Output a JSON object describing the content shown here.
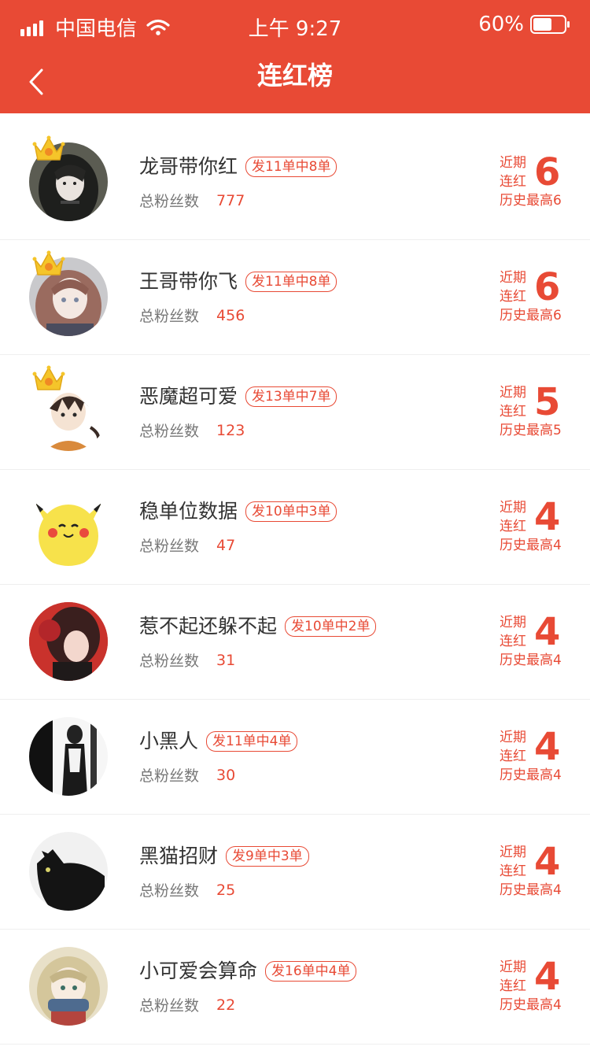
{
  "status_bar": {
    "carrier": "中国电信",
    "time": "上午 9:27",
    "battery": "60%",
    "battery_level": 0.6
  },
  "nav": {
    "title": "连红榜",
    "back_icon": "chevron-left-icon"
  },
  "colors": {
    "accent": "#e84a35",
    "text_primary": "#333333",
    "text_secondary": "#777777"
  },
  "list_labels": {
    "fans_label": "总粉丝数",
    "streak_line1": "近期",
    "streak_line2": "连红"
  },
  "items": [
    {
      "name": "龙哥带你红",
      "badge": "发11单中8单",
      "fans": "777",
      "streak": "6",
      "best": "历史最高6",
      "crown": true,
      "avatar": "avatar-dark-haired-girl"
    },
    {
      "name": "王哥带你飞",
      "badge": "发11单中8单",
      "fans": "456",
      "streak": "6",
      "best": "历史最高6",
      "crown": true,
      "avatar": "avatar-pink-haired-girl"
    },
    {
      "name": "恶魔超可爱",
      "badge": "发13单中7单",
      "fans": "123",
      "streak": "5",
      "best": "历史最高5",
      "crown": true,
      "avatar": "avatar-devil-boy"
    },
    {
      "name": "稳单位数据",
      "badge": "发10单中3单",
      "fans": "47",
      "streak": "4",
      "best": "历史最高4",
      "crown": false,
      "avatar": "avatar-pikachu"
    },
    {
      "name": "惹不起还躲不起",
      "badge": "发10单中2单",
      "fans": "31",
      "streak": "4",
      "best": "历史最高4",
      "crown": false,
      "avatar": "avatar-red-anime-girl"
    },
    {
      "name": "小黑人",
      "badge": "发11单中4单",
      "fans": "30",
      "streak": "4",
      "best": "历史最高4",
      "crown": false,
      "avatar": "avatar-bw-sketch"
    },
    {
      "name": "黑猫招财",
      "badge": "发9单中3单",
      "fans": "25",
      "streak": "4",
      "best": "历史最高4",
      "crown": false,
      "avatar": "avatar-black-cat"
    },
    {
      "name": "小可爱会算命",
      "badge": "发16单中4单",
      "fans": "22",
      "streak": "4",
      "best": "历史最高4",
      "crown": false,
      "avatar": "avatar-scarf-girl"
    }
  ]
}
